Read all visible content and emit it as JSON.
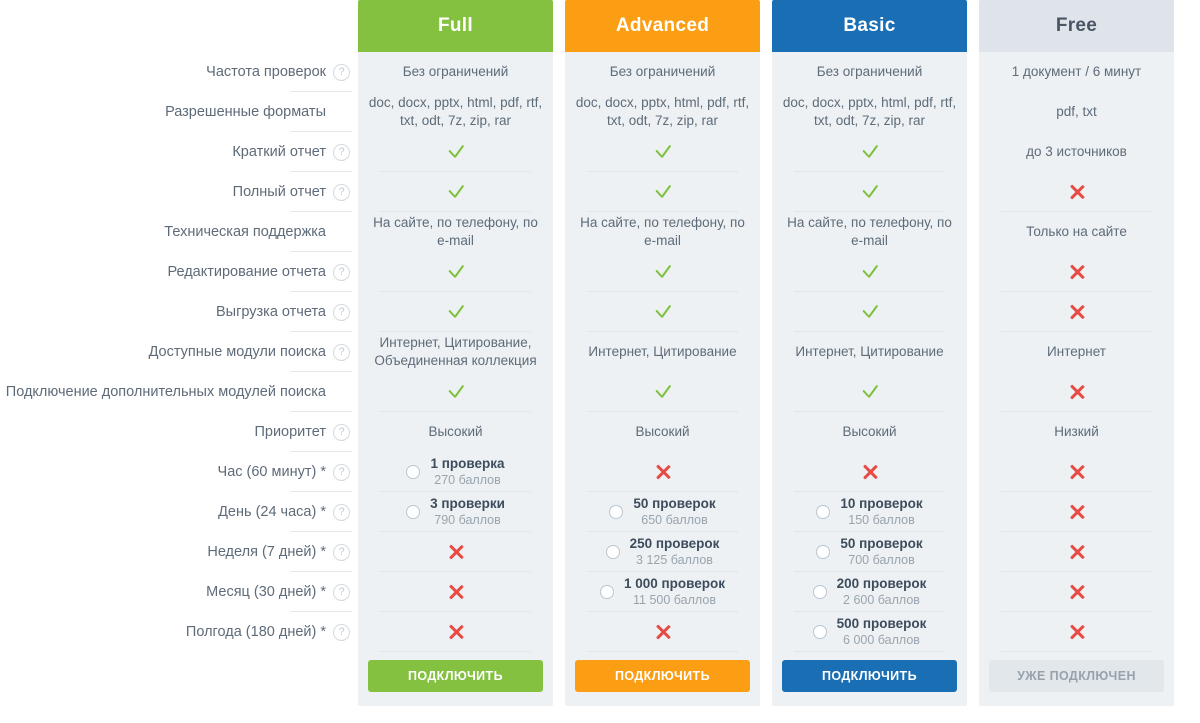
{
  "colors": {
    "full": "#84c141",
    "advanced": "#fb9e13",
    "basic": "#1a6fb4",
    "free_head_bg": "#dfe4ea",
    "tick": "#7ec13d",
    "cross": "#e84b43",
    "panel_bg": "#edf1f3"
  },
  "help_icon_glyph": "?",
  "features": [
    {
      "label": "Частота проверок",
      "help": true
    },
    {
      "label": "Разрешенные форматы",
      "help": false
    },
    {
      "label": "Краткий отчет",
      "help": true
    },
    {
      "label": "Полный отчет",
      "help": true
    },
    {
      "label": "Техническая поддержка",
      "help": false
    },
    {
      "label": "Редактирование отчета",
      "help": true
    },
    {
      "label": "Выгрузка отчета",
      "help": true
    },
    {
      "label": "Доступные модули поиска",
      "help": true
    },
    {
      "label": "Подключение дополнительных модулей поиска",
      "help": false
    },
    {
      "label": "Приоритет",
      "help": true
    },
    {
      "label": "Час (60 минут) *",
      "help": true
    },
    {
      "label": "День (24 часа) *",
      "help": true
    },
    {
      "label": "Неделя (7 дней) *",
      "help": true
    },
    {
      "label": "Месяц (30 дней) *",
      "help": true
    },
    {
      "label": "Полгода (180 дней) *",
      "help": true
    }
  ],
  "plans": [
    {
      "name": "Full",
      "accent": "#84c141",
      "cta_label": "Подключить",
      "cta_disabled": false,
      "cells": [
        {
          "type": "text",
          "value": "Без ограничений"
        },
        {
          "type": "text",
          "value": "doc, docx, pptx, html, pdf, rtf, txt, odt, 7z, zip, rar"
        },
        {
          "type": "tick"
        },
        {
          "type": "tick"
        },
        {
          "type": "text",
          "value": "На сайте, по телефону, по e-mail"
        },
        {
          "type": "tick"
        },
        {
          "type": "tick"
        },
        {
          "type": "text",
          "value": "Интернет, Цитирование, Объединенная коллекция"
        },
        {
          "type": "tick"
        },
        {
          "type": "text",
          "value": "Высокий"
        },
        {
          "type": "option",
          "title": "1 проверка",
          "sub": "270 баллов"
        },
        {
          "type": "option",
          "title": "3 проверки",
          "sub": "790 баллов"
        },
        {
          "type": "cross"
        },
        {
          "type": "cross"
        },
        {
          "type": "cross"
        }
      ]
    },
    {
      "name": "Advanced",
      "accent": "#fb9e13",
      "cta_label": "Подключить",
      "cta_disabled": false,
      "cells": [
        {
          "type": "text",
          "value": "Без ограничений"
        },
        {
          "type": "text",
          "value": "doc, docx, pptx, html, pdf, rtf, txt, odt, 7z, zip, rar"
        },
        {
          "type": "tick"
        },
        {
          "type": "tick"
        },
        {
          "type": "text",
          "value": "На сайте, по телефону, по e-mail"
        },
        {
          "type": "tick"
        },
        {
          "type": "tick"
        },
        {
          "type": "text",
          "value": "Интернет, Цитирование"
        },
        {
          "type": "tick"
        },
        {
          "type": "text",
          "value": "Высокий"
        },
        {
          "type": "cross"
        },
        {
          "type": "option",
          "title": "50 проверок",
          "sub": "650 баллов"
        },
        {
          "type": "option",
          "title": "250 проверок",
          "sub": "3 125 баллов"
        },
        {
          "type": "option",
          "title": "1 000 проверок",
          "sub": "11 500 баллов"
        },
        {
          "type": "cross"
        }
      ]
    },
    {
      "name": "Basic",
      "accent": "#1a6fb4",
      "cta_label": "Подключить",
      "cta_disabled": false,
      "cells": [
        {
          "type": "text",
          "value": "Без ограничений"
        },
        {
          "type": "text",
          "value": "doc, docx, pptx, html, pdf, rtf, txt, odt, 7z, zip, rar"
        },
        {
          "type": "tick"
        },
        {
          "type": "tick"
        },
        {
          "type": "text",
          "value": "На сайте, по телефону, по e-mail"
        },
        {
          "type": "tick"
        },
        {
          "type": "tick"
        },
        {
          "type": "text",
          "value": "Интернет, Цитирование"
        },
        {
          "type": "tick"
        },
        {
          "type": "text",
          "value": "Высокий"
        },
        {
          "type": "cross"
        },
        {
          "type": "option",
          "title": "10 проверок",
          "sub": "150 баллов"
        },
        {
          "type": "option",
          "title": "50 проверок",
          "sub": "700 баллов"
        },
        {
          "type": "option",
          "title": "200 проверок",
          "sub": "2 600 баллов"
        },
        {
          "type": "option",
          "title": "500 проверок",
          "sub": "6 000 баллов"
        }
      ]
    },
    {
      "name": "Free",
      "accent": "#dfe4ea",
      "cta_label": "Уже подключен",
      "cta_disabled": true,
      "cells": [
        {
          "type": "text",
          "value": "1 документ / 6 минут"
        },
        {
          "type": "text",
          "value": "pdf, txt"
        },
        {
          "type": "text",
          "value": "до 3 источников"
        },
        {
          "type": "cross"
        },
        {
          "type": "text",
          "value": "Только на сайте"
        },
        {
          "type": "cross"
        },
        {
          "type": "cross"
        },
        {
          "type": "text",
          "value": "Интернет"
        },
        {
          "type": "cross"
        },
        {
          "type": "text",
          "value": "Низкий"
        },
        {
          "type": "cross"
        },
        {
          "type": "cross"
        },
        {
          "type": "cross"
        },
        {
          "type": "cross"
        },
        {
          "type": "cross"
        }
      ]
    }
  ]
}
